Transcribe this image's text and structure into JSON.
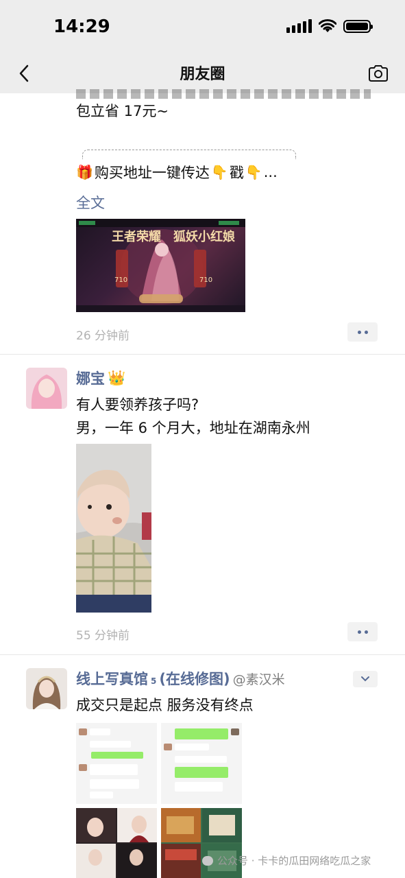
{
  "status_bar": {
    "time": "14:29"
  },
  "nav": {
    "title": "朋友圈"
  },
  "post1": {
    "text_line1": "包立省 17元~",
    "text_line2": "购买地址一键传达",
    "text_line2_tail": "戳",
    "ellipsis": "...",
    "expand_label": "全文",
    "time": "26 分钟前"
  },
  "post2": {
    "author": "娜宝",
    "text_line1": "有人要领养孩子吗?",
    "text_line2": "男，一年 6 个月大，地址在湖南永州",
    "time": "55 分钟前"
  },
  "post3": {
    "author": "线上写真馆",
    "author_sup": "5",
    "author_suffix": "(在线修图)",
    "author_handle": "@素汉米",
    "text_line1": "成交只是起点 服务没有终点"
  },
  "watermark": "公众号 · 卡卡的瓜田网络吃瓜之家",
  "icons": {
    "back": "chevron-left-icon",
    "camera": "camera-icon",
    "more": "more-dots-icon",
    "fold": "chevron-down-icon",
    "crown": "crown-icon",
    "gift": "gift-icon",
    "point_down": "pointing-down-icon"
  },
  "colors": {
    "link": "#576b95",
    "nav_bg": "#ededed",
    "time_gray": "#b2b2b2"
  }
}
